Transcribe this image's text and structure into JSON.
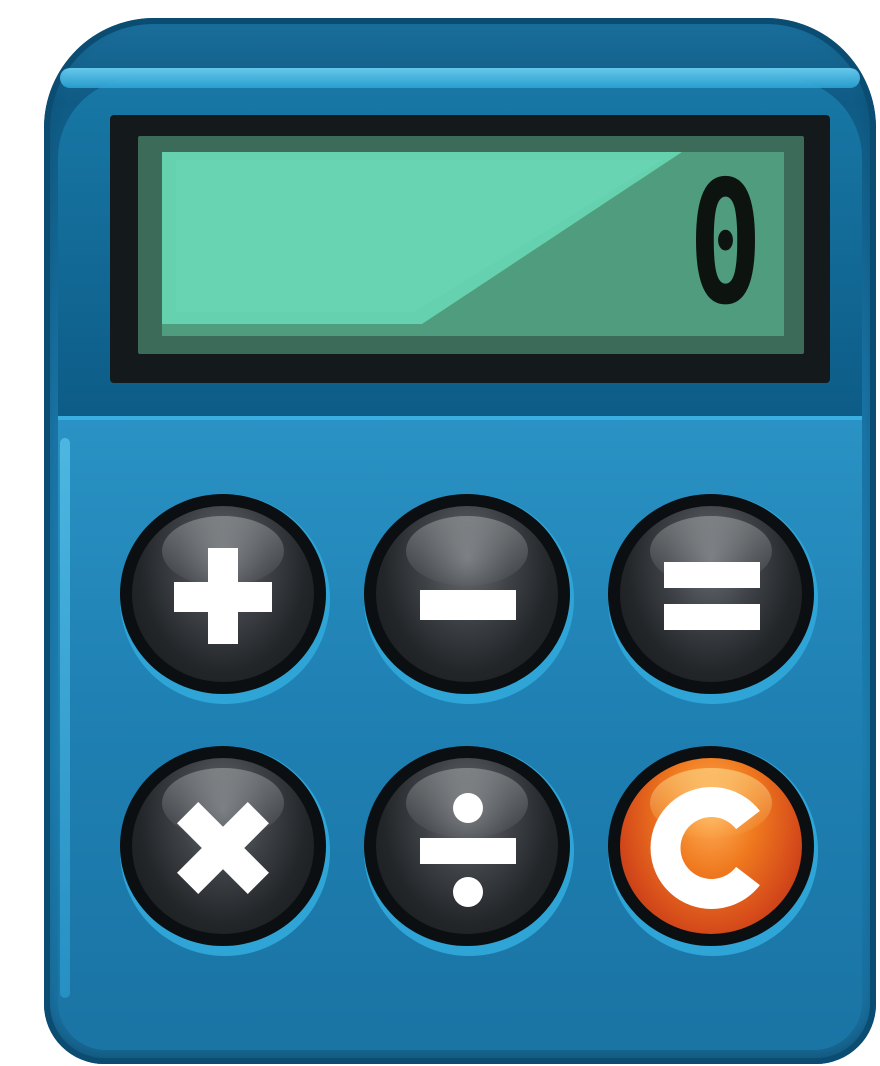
{
  "display": {
    "value": "0"
  },
  "keys": [
    {
      "name": "plus-button",
      "symbol": "plus-icon"
    },
    {
      "name": "minus-button",
      "symbol": "minus-icon"
    },
    {
      "name": "equals-button",
      "symbol": "equals-icon"
    },
    {
      "name": "multiply-button",
      "symbol": "multiply-icon"
    },
    {
      "name": "divide-button",
      "symbol": "divide-icon"
    },
    {
      "name": "clear-button",
      "symbol": "clear-c-icon"
    }
  ],
  "colors": {
    "body": "#1a76a8",
    "screen": "#4f9c7f",
    "key_dark": "#232629",
    "key_clear": "#f07a1f",
    "symbol": "#ffffff"
  }
}
